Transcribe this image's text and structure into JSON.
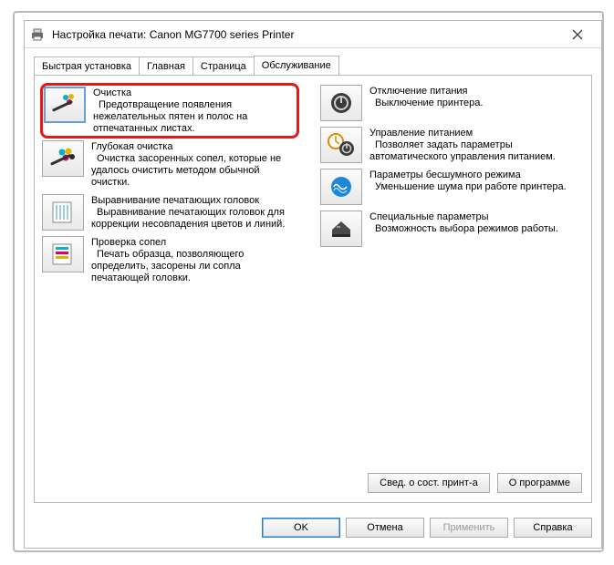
{
  "window": {
    "title": "Настройка печати: Canon MG7700 series Printer"
  },
  "tabs": {
    "items": [
      {
        "label": "Быстрая установка"
      },
      {
        "label": "Главная"
      },
      {
        "label": "Страница"
      },
      {
        "label": "Обслуживание"
      }
    ],
    "active_index": 3
  },
  "left_items": [
    {
      "title": "Очистка",
      "desc": "Предотвращение появления нежелательных пятен и полос на отпечатанных листах.",
      "icon": "cleaning-icon",
      "highlight": true
    },
    {
      "title": "Глубокая очистка",
      "desc": "Очистка засоренных сопел, которые не удалось очистить методом обычной очистки.",
      "icon": "deep-cleaning-icon"
    },
    {
      "title": "Выравнивание печатающих головок",
      "desc": "Выравнивание печатающих головок для коррекции несовпадения цветов и линий.",
      "icon": "alignment-icon"
    },
    {
      "title": "Проверка сопел",
      "desc": "Печать образца, позволяющего определить, засорены ли сопла печатающей головки.",
      "icon": "nozzle-check-icon"
    }
  ],
  "right_items": [
    {
      "title": "Отключение питания",
      "desc": "Выключение принтера.",
      "icon": "power-off-icon"
    },
    {
      "title": "Управление питанием",
      "desc": "Позволяет задать параметры автоматического управления питанием.",
      "icon": "power-management-icon"
    },
    {
      "title": "Параметры бесшумного режима",
      "desc": "Уменьшение шума при работе принтера.",
      "icon": "quiet-mode-icon"
    },
    {
      "title": "Специальные параметры",
      "desc": "Возможность выбора режимов работы.",
      "icon": "custom-settings-icon"
    }
  ],
  "panel_buttons": {
    "status": "Свед. о сост. принт-а",
    "about": "О программе"
  },
  "dialog_buttons": {
    "ok": "OK",
    "cancel": "Отмена",
    "apply": "Применить",
    "help": "Справка"
  }
}
